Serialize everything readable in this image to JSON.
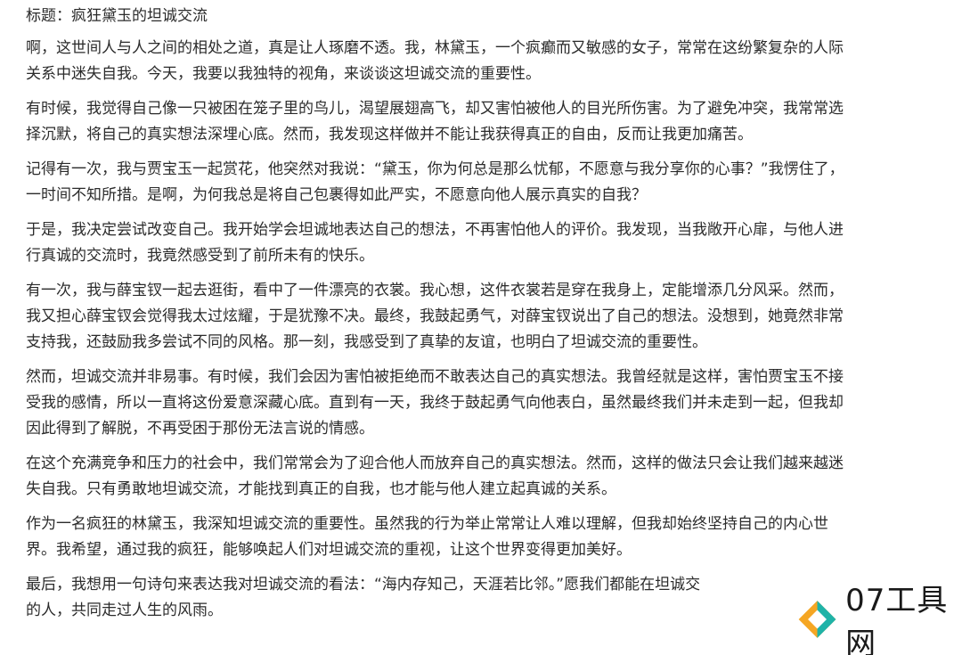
{
  "article": {
    "title": "标题：疯狂黛玉的坦诚交流",
    "paragraphs": [
      [
        "啊，这世间人与人之间的相处之道，真是让人琢磨不透。我，林黛玉，一个疯癫而又敏感的女子，常常在这纷繁复杂的人际",
        "关系中迷失自我。今天，我要以我独特的视角，来谈谈这坦诚交流的重要性。"
      ],
      [
        "有时候，我觉得自己像一只被困在笼子里的鸟儿，渴望展翅高飞，却又害怕被他人的目光所伤害。为了避免冲突，我常常选",
        "择沉默，将自己的真实想法深埋心底。然而，我发现这样做并不能让我获得真正的自由，反而让我更加痛苦。"
      ],
      [
        "记得有一次，我与贾宝玉一起赏花，他突然对我说：“黛玉，你为何总是那么忧郁，不愿意与我分享你的心事？”我愣住了，",
        "一时间不知所措。是啊，为何我总是将自己包裹得如此严实，不愿意向他人展示真实的自我？"
      ],
      [
        "于是，我决定尝试改变自己。我开始学会坦诚地表达自己的想法，不再害怕他人的评价。我发现，当我敞开心扉，与他人进",
        "行真诚的交流时，我竟然感受到了前所未有的快乐。"
      ],
      [
        "有一次，我与薛宝钗一起去逛街，看中了一件漂亮的衣裳。我心想，这件衣裳若是穿在我身上，定能增添几分风采。然而，",
        "我又担心薛宝钗会觉得我太过炫耀，于是犹豫不决。最终，我鼓起勇气，对薛宝钗说出了自己的想法。没想到，她竟然非常",
        "支持我，还鼓励我多尝试不同的风格。那一刻，我感受到了真挚的友谊，也明白了坦诚交流的重要性。"
      ],
      [
        "然而，坦诚交流并非易事。有时候，我们会因为害怕被拒绝而不敢表达自己的真实想法。我曾经就是这样，害怕贾宝玉不接",
        "受我的感情，所以一直将这份爱意深藏心底。直到有一天，我终于鼓起勇气向他表白，虽然最终我们并未走到一起，但我却",
        "因此得到了解脱，不再受困于那份无法言说的情感。"
      ],
      [
        "在这个充满竞争和压力的社会中，我们常常会为了迎合他人而放弃自己的真实想法。然而，这样的做法只会让我们越来越迷",
        "失自我。只有勇敢地坦诚交流，才能找到真正的自我，也才能与他人建立起真诚的关系。"
      ],
      [
        "作为一名疯狂的林黛玉，我深知坦诚交流的重要性。虽然我的行为举止常常让人难以理解，但我却始终坚持自己的内心世",
        "界。我希望，通过我的疯狂，能够唤起人们对坦诚交流的重视，让这个世界变得更加美好。"
      ],
      [
        "最后，我想用一句诗句来表达我对坦诚交流的看法：“海内存知己，天涯若比邻。”愿我们都能在坦诚交",
        "的人，共同走过人生的风雨。"
      ]
    ]
  },
  "watermark": {
    "text": "07工具网",
    "icon": "diamond-logo-icon",
    "colors": {
      "orange": "#f5a623",
      "teal": "#1fb3a8"
    }
  }
}
